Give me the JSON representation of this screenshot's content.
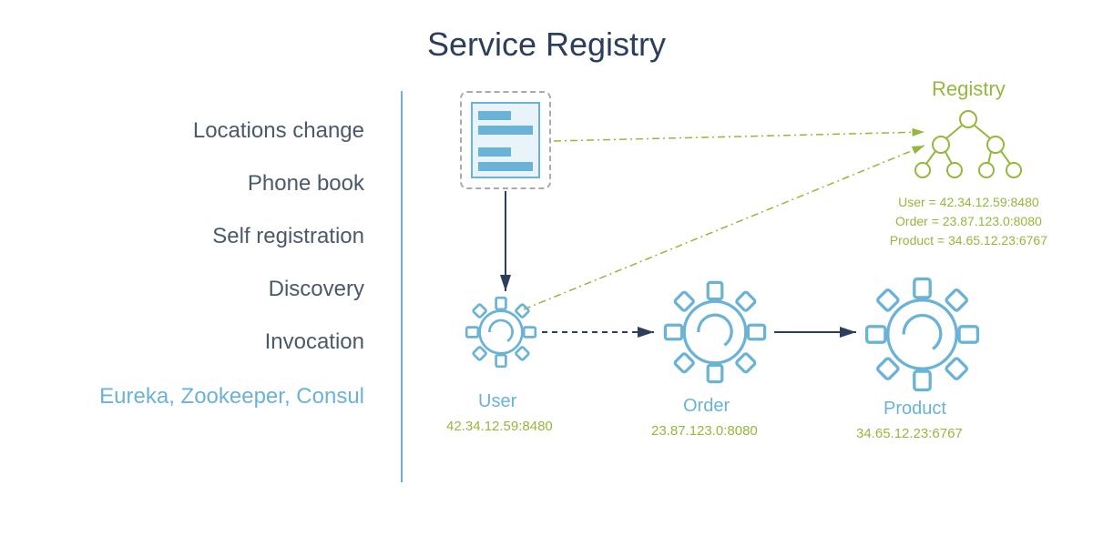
{
  "title": "Service Registry",
  "sidebar": {
    "items": [
      "Locations change",
      "Phone book",
      "Self registration",
      "Discovery",
      "Invocation"
    ],
    "highlight": "Eureka, Zookeeper, Consul"
  },
  "registry": {
    "label": "Registry",
    "entries": [
      "User = 42.34.12.59:8480",
      "Order = 23.87.123.0:8080",
      "Product = 34.65.12.23:6767"
    ]
  },
  "services": {
    "user": {
      "label": "User",
      "addr": "42.34.12.59:8480"
    },
    "order": {
      "label": "Order",
      "addr": "23.87.123.0:8080"
    },
    "product": {
      "label": "Product",
      "addr": "34.65.12.23:6767"
    }
  },
  "colors": {
    "navy": "#2c3e5c",
    "blue": "#6bb3d6",
    "olive": "#93b83c",
    "gray": "#4a5a6a"
  }
}
